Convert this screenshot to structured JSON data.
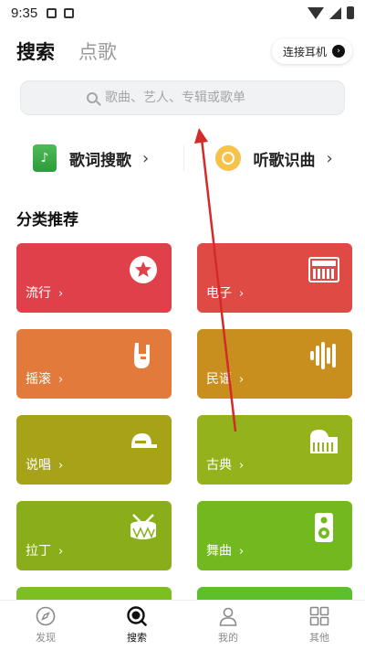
{
  "status": {
    "time": "9:35"
  },
  "header": {
    "tabs": [
      {
        "label": "搜索",
        "active": true
      },
      {
        "label": "点歌",
        "active": false
      }
    ],
    "connect_label": "连接耳机"
  },
  "search": {
    "placeholder": "歌曲、艺人、专辑或歌单"
  },
  "features": [
    {
      "label": "歌词搜歌",
      "icon": "lyric-note-icon"
    },
    {
      "label": "听歌识曲",
      "icon": "listen-icon"
    }
  ],
  "section_title": "分类推荐",
  "categories": [
    {
      "label": "流行",
      "color": "#e0404a",
      "icon": "star-badge-icon"
    },
    {
      "label": "电子",
      "color": "#e04a44",
      "icon": "keyboard-synth-icon"
    },
    {
      "label": "摇滚",
      "color": "#e27a3c",
      "icon": "rock-hand-icon"
    },
    {
      "label": "民谣",
      "color": "#c98f1e",
      "icon": "sound-wave-icon"
    },
    {
      "label": "说唱",
      "color": "#a6a318",
      "icon": "cap-icon"
    },
    {
      "label": "古典",
      "color": "#93b21c",
      "icon": "piano-icon"
    },
    {
      "label": "拉丁",
      "color": "#8aae19",
      "icon": "drum-icon"
    },
    {
      "label": "舞曲",
      "color": "#72b81f",
      "icon": "speaker-icon"
    }
  ],
  "nav": [
    {
      "label": "发现",
      "icon": "compass-icon",
      "active": false
    },
    {
      "label": "搜索",
      "icon": "search-circle-icon",
      "active": true
    },
    {
      "label": "我的",
      "icon": "person-icon",
      "active": false
    },
    {
      "label": "其他",
      "icon": "grid-icon",
      "active": false
    }
  ],
  "colors": {
    "partial_card_left": "#7cbf22",
    "partial_card_right": "#5cc02a",
    "annotation_arrow": "#d42a2a"
  }
}
